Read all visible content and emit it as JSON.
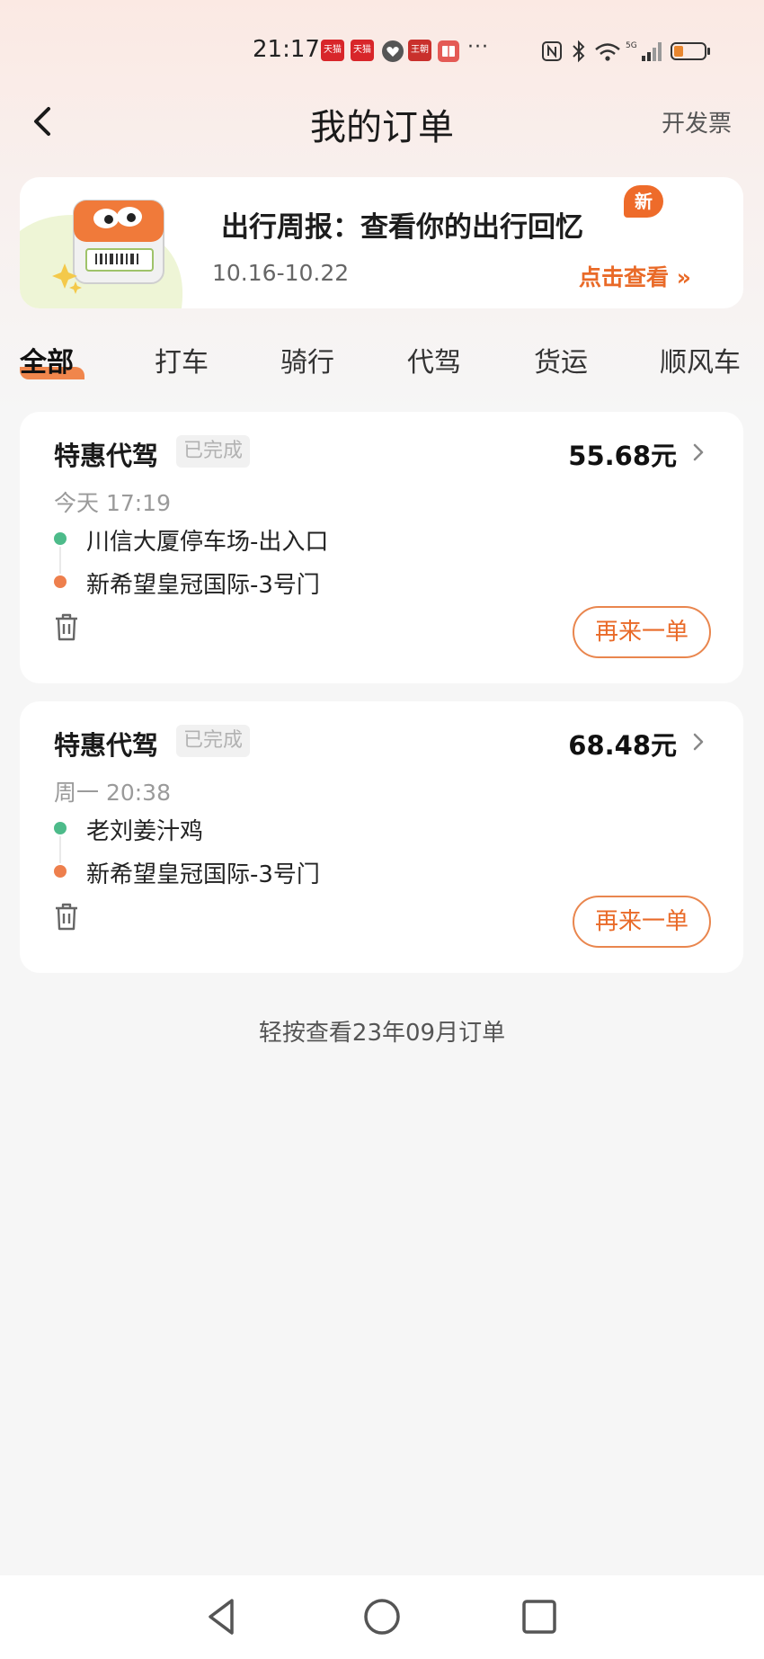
{
  "status_bar": {
    "time": "21:17",
    "app_badges": [
      "天猫",
      "天猫",
      "王朝"
    ],
    "more": "···",
    "network": "5G",
    "icons": [
      "nfc-icon",
      "bluetooth-icon",
      "wifi-icon",
      "signal-icon",
      "battery-icon"
    ]
  },
  "header": {
    "title": "我的订单",
    "invoice_label": "开发票"
  },
  "banner": {
    "title": "出行周报：查看你的出行回忆",
    "date_range": "10.16-10.22",
    "link_label": "点击查看 »",
    "badge": "新"
  },
  "tabs": [
    {
      "label": "全部",
      "active": true
    },
    {
      "label": "打车",
      "active": false
    },
    {
      "label": "骑行",
      "active": false
    },
    {
      "label": "代驾",
      "active": false
    },
    {
      "label": "货运",
      "active": false
    },
    {
      "label": "顺风车",
      "active": false
    }
  ],
  "orders": [
    {
      "type": "特惠代驾",
      "status": "已完成",
      "price": "55.68元",
      "time": "今天 17:19",
      "from": "川信大厦停车场-出入口",
      "to": "新希望皇冠国际-3号门",
      "reorder_label": "再来一单"
    },
    {
      "type": "特惠代驾",
      "status": "已完成",
      "price": "68.48元",
      "time": "周一 20:38",
      "from": "老刘姜汁鸡",
      "to": "新希望皇冠国际-3号门",
      "reorder_label": "再来一单"
    }
  ],
  "history_link": "轻按查看23年09月订单",
  "colors": {
    "accent": "#e96a28",
    "start_dot": "#4dbb8a",
    "end_dot": "#ee7f4d",
    "background": "#f6f6f6"
  }
}
